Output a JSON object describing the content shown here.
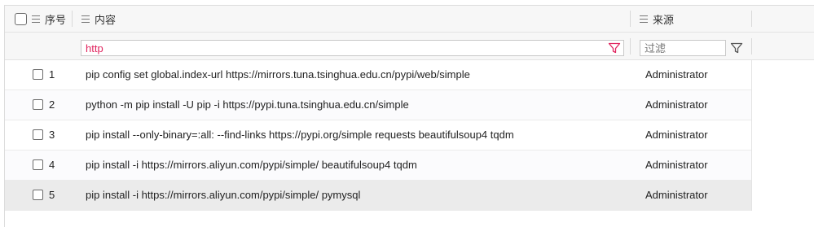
{
  "header": {
    "col_index": "序号",
    "col_content": "内容",
    "col_source": "来源"
  },
  "filter": {
    "content_value": "http",
    "source_placeholder": "过滤"
  },
  "colors": {
    "content_filter_text": "#e0245e",
    "funnel_active": "#e0245e",
    "funnel_inactive": "#555555"
  },
  "icons": {
    "header": "list-icon",
    "filter": "funnel-icon"
  },
  "rows": [
    {
      "index": "1",
      "content": "pip config set global.index-url https://mirrors.tuna.tsinghua.edu.cn/pypi/web/simple",
      "source": "Administrator"
    },
    {
      "index": "2",
      "content": "python -m pip install -U pip -i https://pypi.tuna.tsinghua.edu.cn/simple",
      "source": "Administrator"
    },
    {
      "index": "3",
      "content": "pip install --only-binary=:all: --find-links https://pypi.org/simple requests beautifulsoup4 tqdm",
      "source": "Administrator"
    },
    {
      "index": "4",
      "content": "pip install -i https://mirrors.aliyun.com/pypi/simple/ beautifulsoup4 tqdm",
      "source": "Administrator"
    },
    {
      "index": "5",
      "content": "pip install -i https://mirrors.aliyun.com/pypi/simple/ pymysql",
      "source": "Administrator"
    }
  ]
}
